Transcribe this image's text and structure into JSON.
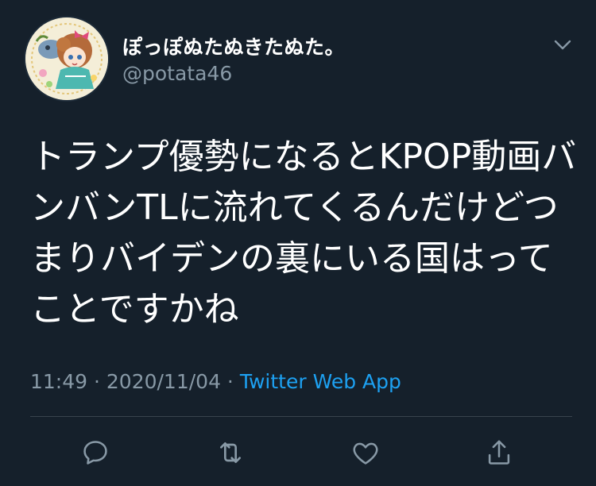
{
  "tweet": {
    "display_name": "ぽっぽぬたぬきたぬた。",
    "handle": "@potata46",
    "text": "トランプ優勢になるとKPOP動画バンバンTLに流れてくるんだけどつまりバイデンの裏にいる国はってことですかね",
    "time": "11:49",
    "separator": " · ",
    "date": "2020/11/04",
    "source": "Twitter Web App"
  },
  "actions": [
    {
      "icon": "reply-icon"
    },
    {
      "icon": "retweet-icon"
    },
    {
      "icon": "like-icon"
    },
    {
      "icon": "share-icon"
    }
  ],
  "colors": {
    "background": "#15202b",
    "text": "#ffffff",
    "secondary": "#8899a6",
    "link": "#1da1f2",
    "divider": "#38444d"
  }
}
